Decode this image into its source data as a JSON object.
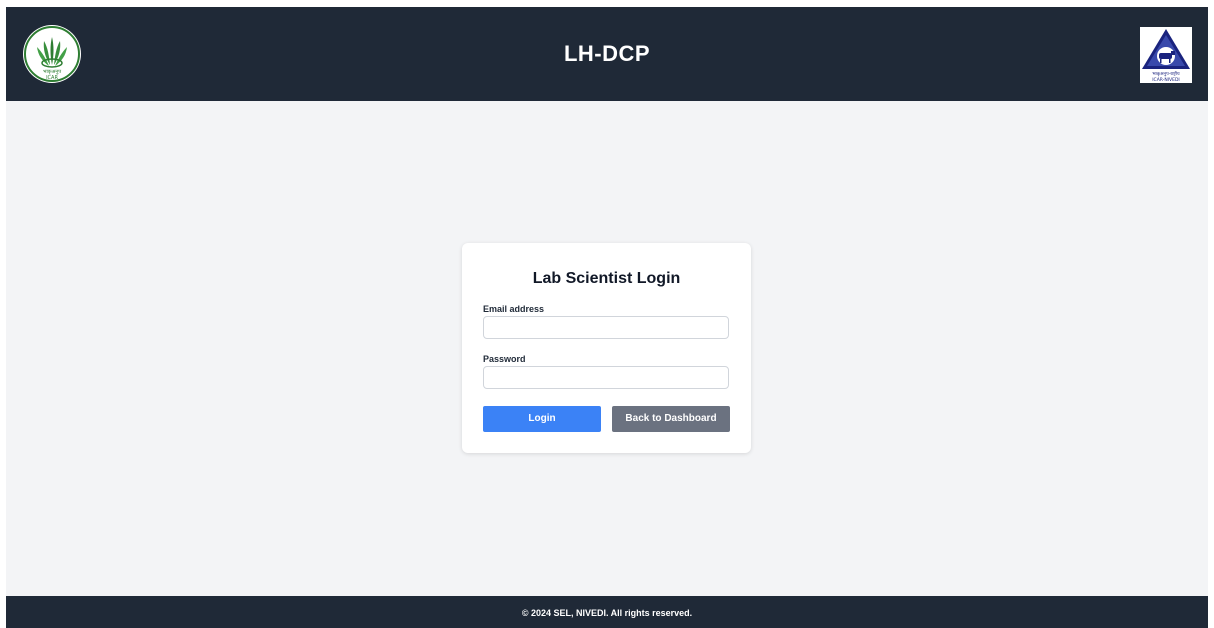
{
  "header": {
    "title": "LH-DCP",
    "left_logo": {
      "icon": "icar-wheat-emblem-icon",
      "caption_top": "भाकृअनुप",
      "caption_bottom": "ICAR"
    },
    "right_logo": {
      "icon": "nivedi-cow-triangle-icon",
      "caption_top": "भाकृअनुप-राष्ट्रीय",
      "caption_bottom": "ICAR-NIVEDI"
    }
  },
  "login": {
    "title": "Lab Scientist Login",
    "email_label": "Email address",
    "email_value": "",
    "email_placeholder": "",
    "password_label": "Password",
    "password_value": "",
    "password_placeholder": "",
    "login_button": "Login",
    "back_button": "Back to Dashboard"
  },
  "footer": {
    "text": "© 2024 SEL, NIVEDI. All rights reserved."
  },
  "colors": {
    "header_bg": "#1f2937",
    "page_bg": "#f3f4f6",
    "primary": "#3b82f6",
    "secondary": "#6b7280"
  }
}
